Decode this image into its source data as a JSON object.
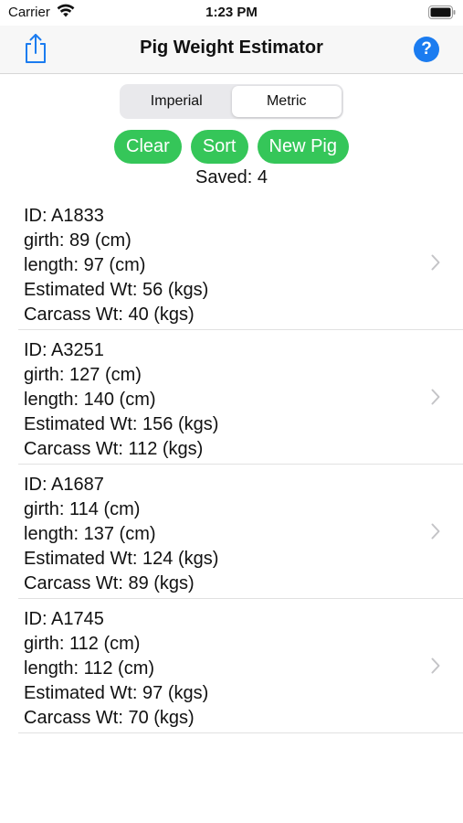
{
  "status_bar": {
    "carrier": "Carrier",
    "time": "1:23 PM",
    "icons": [
      "wifi-icon",
      "battery-icon"
    ]
  },
  "nav": {
    "title": "Pig Weight Estimator",
    "share_icon": "share-icon",
    "help_label": "?"
  },
  "units": {
    "options": [
      "Imperial",
      "Metric"
    ],
    "selected": "Metric"
  },
  "actions": {
    "clear_label": "Clear",
    "sort_label": "Sort",
    "new_pig_label": "New Pig"
  },
  "saved_text": "Saved: 4",
  "pigs": [
    {
      "id": "ID: A1833",
      "girth": "girth: 89 (cm)",
      "length": "length: 97 (cm)",
      "estimated": "Estimated Wt: 56 (kgs)",
      "carcass": "Carcass Wt: 40 (kgs)"
    },
    {
      "id": "ID: A3251",
      "girth": "girth: 127 (cm)",
      "length": "length: 140 (cm)",
      "estimated": "Estimated Wt: 156 (kgs)",
      "carcass": "Carcass Wt: 112 (kgs)"
    },
    {
      "id": "ID: A1687",
      "girth": "girth: 114 (cm)",
      "length": "length: 137 (cm)",
      "estimated": "Estimated Wt: 124 (kgs)",
      "carcass": "Carcass Wt: 89 (kgs)"
    },
    {
      "id": "ID: A1745",
      "girth": "girth: 112 (cm)",
      "length": "length: 112 (cm)",
      "estimated": "Estimated Wt: 97 (kgs)",
      "carcass": "Carcass Wt: 70 (kgs)"
    }
  ],
  "colors": {
    "accent_green": "#35c659",
    "help_blue": "#1b7cf0",
    "share_blue": "#1b7cf0"
  }
}
